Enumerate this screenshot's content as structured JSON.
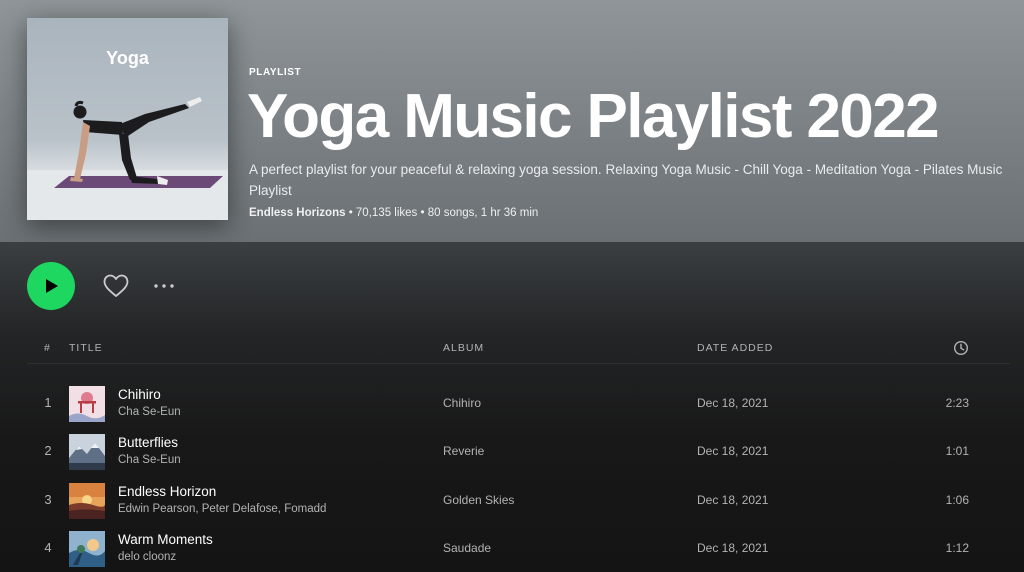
{
  "playlist": {
    "cover_title": "Yoga",
    "type_label": "PLAYLIST",
    "title": "Yoga Music Playlist 2022",
    "description": "A perfect playlist for your peaceful & relaxing yoga session. Relaxing Yoga Music - Chill Yoga - Meditation Yoga - Pilates Music Playlist",
    "owner": "Endless Horizons",
    "stats": " • 70,135 likes • 80 songs, 1 hr 36 min"
  },
  "controls": {
    "play_icon": "play-icon",
    "like_icon": "heart-icon",
    "more_icon": "more-horizontal-icon"
  },
  "table": {
    "columns": {
      "num": "#",
      "title": "TITLE",
      "album": "ALBUM",
      "date_added": "DATE ADDED",
      "duration_icon": "clock-icon"
    },
    "rows": [
      {
        "num": "1",
        "title": "Chihiro",
        "artist": "Cha Se-Eun",
        "album": "Chihiro",
        "date_added": "Dec 18, 2021",
        "duration": "2:23"
      },
      {
        "num": "2",
        "title": "Butterflies",
        "artist": "Cha Se-Eun",
        "album": "Reverie",
        "date_added": "Dec 18, 2021",
        "duration": "1:01"
      },
      {
        "num": "3",
        "title": "Endless Horizon",
        "artist": "Edwin Pearson, Peter Delafose, Fomadd",
        "album": "Golden Skies",
        "date_added": "Dec 18, 2021",
        "duration": "1:06"
      },
      {
        "num": "4",
        "title": "Warm Moments",
        "artist": "delo cloonz",
        "album": "Saudade",
        "date_added": "Dec 18, 2021",
        "duration": "1:12"
      }
    ]
  },
  "colors": {
    "accent": "#1ed760",
    "background": "#121212",
    "hero_gradient": "#8f9598",
    "secondary_text": "#b3b3b3"
  }
}
